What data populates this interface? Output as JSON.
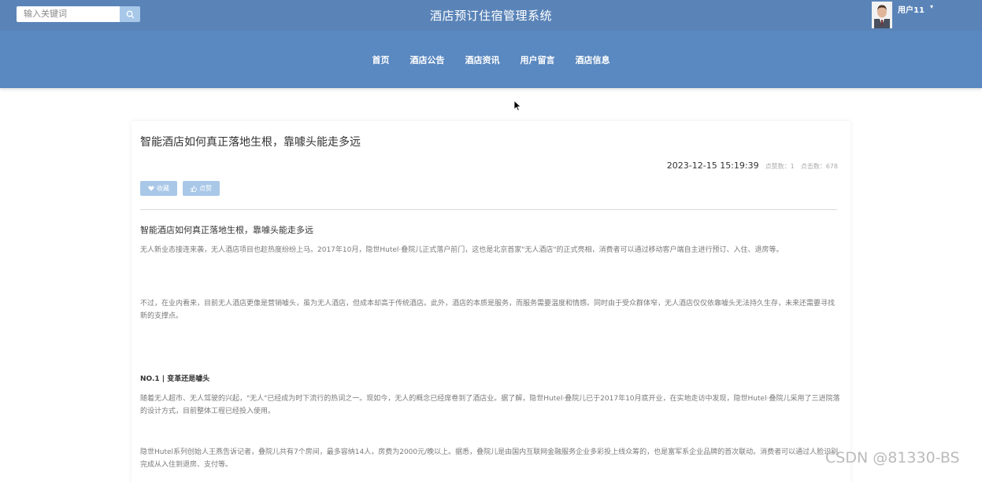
{
  "header": {
    "search_placeholder": "输入关键词",
    "site_title": "酒店预订住宿管理系统",
    "user_name": "用户11",
    "caret": "▾"
  },
  "nav": {
    "items": [
      "首页",
      "酒店公告",
      "酒店资讯",
      "用户留言",
      "酒店信息"
    ]
  },
  "article": {
    "title": "智能酒店如何真正落地生根，靠噱头能走多远",
    "datetime": "2023-12-15 15:19:39",
    "likes_label": "点赞数：1",
    "clicks_label": "点击数：678",
    "favorite_label": "收藏",
    "like_label": "点赞",
    "content_title": "智能酒店如何真正落地生根，靠噱头能走多远",
    "paragraphs": [
      "无人新业态接连来袭，无人酒店项目也趁热度纷纷上马。2017年10月，隐世Hutel·叠院儿正式落户前门，这也是北京首家\"无人酒店\"的正式亮相，消费者可以通过移动客户端自主进行预订、入住、退房等。",
      "不过，在业内看来，目前无人酒店更像是营销噱头，虽为无人酒店，但成本却高于传统酒店。此外，酒店的本质是服务，而服务需要温度和情感。同时由于受众群体窄，无人酒店仅仅依靠噱头无法持久生存，未来还需要寻找新的支撑点。",
      "随着无人超市、无人驾驶的兴起，\"无人\"已经成为时下流行的热词之一。现如今，无人的概念已经席卷到了酒店业。据了解，隐世Hutel·叠院儿已于2017年10月底开业，在实地走访中发现，隐世Hutel·叠院儿采用了三进院落的设计方式，目前整体工程已经投入使用。",
      "隐世Hutel系列创始人王燕告诉记者，叠院儿共有7个房间，最多容纳14人，房费为2000元/晚以上。据悉，叠院儿是由国内互联网金融服务企业多彩投上线众筹的，也是富军系企业品牌的首次联动。消费者可以通过人脸识别完成从入住到退房、支付等。"
    ],
    "section_head": "NO.1 | 变革还是噱头"
  },
  "watermark": "CSDN @81330-BS",
  "colors": {
    "header_bg": "#5a84b8",
    "nav_bg": "#5a88c0",
    "button_bg": "#a9c8e8"
  }
}
